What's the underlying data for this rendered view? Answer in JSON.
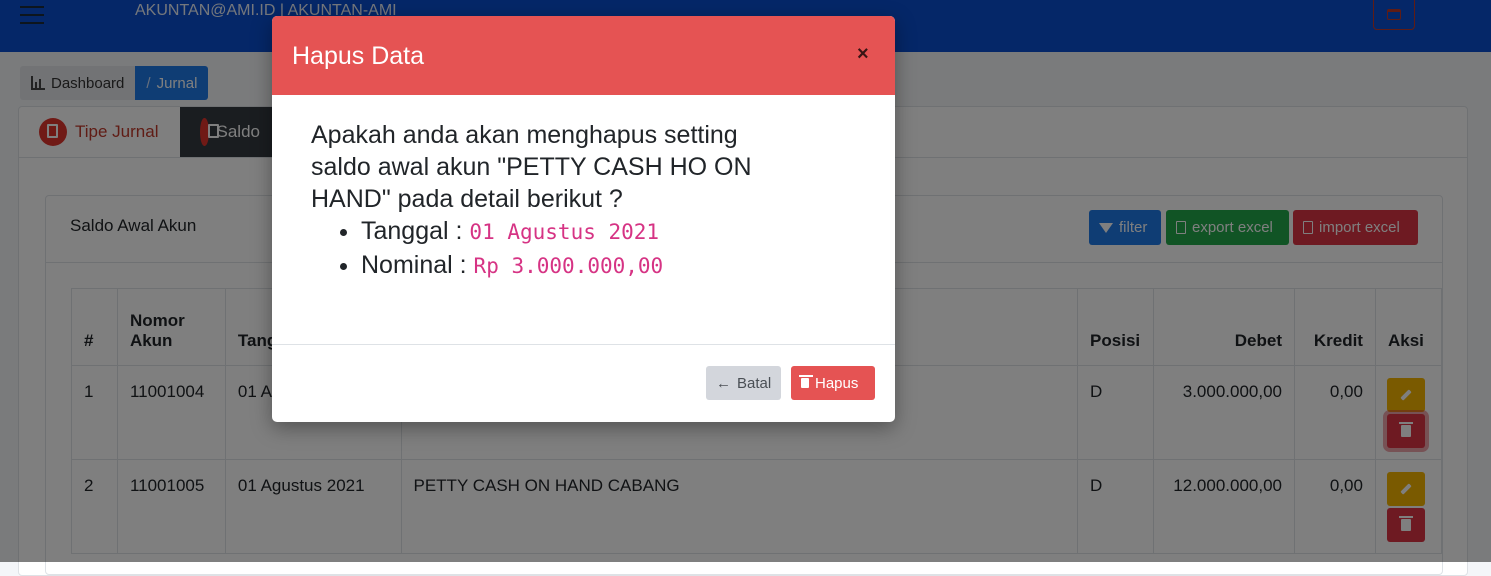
{
  "topbar": {
    "user": "AKUNTAN@AMI.ID | AKUNTAN-AMI",
    "menu_icon": "hamburger-icon",
    "right_icon": "window-icon"
  },
  "breadcrumb": {
    "home": "Dashboard",
    "separator": "/",
    "current": "Jurnal"
  },
  "tabs": [
    {
      "label": "Tipe Jurnal",
      "icon": "document-icon"
    },
    {
      "label": "Saldo",
      "icon": "money-icon"
    }
  ],
  "card": {
    "title": "Saldo Awal Akun",
    "filter_label": "filter",
    "export_label": "export excel",
    "import_label": "import excel"
  },
  "table": {
    "headers": {
      "no": "#",
      "nomor_akun": "Nomor Akun",
      "tanggal": "Tang",
      "posisi": "Posisi",
      "debet": "Debet",
      "kredit": "Kredit",
      "aksi": "Aksi"
    },
    "rows": [
      {
        "no": "1",
        "nomor_akun": "11001004",
        "tanggal": "01 A",
        "nama": "",
        "posisi": "D",
        "debet": "3.000.000,00",
        "kredit": "0,00"
      },
      {
        "no": "2",
        "nomor_akun": "11001005",
        "tanggal": "01 Agustus 2021",
        "nama": "PETTY CASH ON HAND CABANG",
        "posisi": "D",
        "debet": "12.000.000,00",
        "kredit": "0,00"
      }
    ]
  },
  "modal": {
    "title": "Hapus Data",
    "close": "×",
    "message": "Apakah anda akan menghapus setting saldo awal akun \"PETTY CASH HO ON HAND\" pada detail berikut ?",
    "tanggal_label": "Tanggal :",
    "tanggal_value": "01 Agustus 2021",
    "nominal_label": "Nominal :",
    "nominal_value": "Rp 3.000.000,00",
    "cancel_label": "Batal",
    "cancel_arrow": "←",
    "delete_label": "Hapus"
  },
  "colors": {
    "topbar": "#0a4fd0",
    "modal_header": "#e55353",
    "primary": "#1f7ae8",
    "success": "#22a84a",
    "danger": "#dc3545",
    "warning": "#f4b400"
  }
}
